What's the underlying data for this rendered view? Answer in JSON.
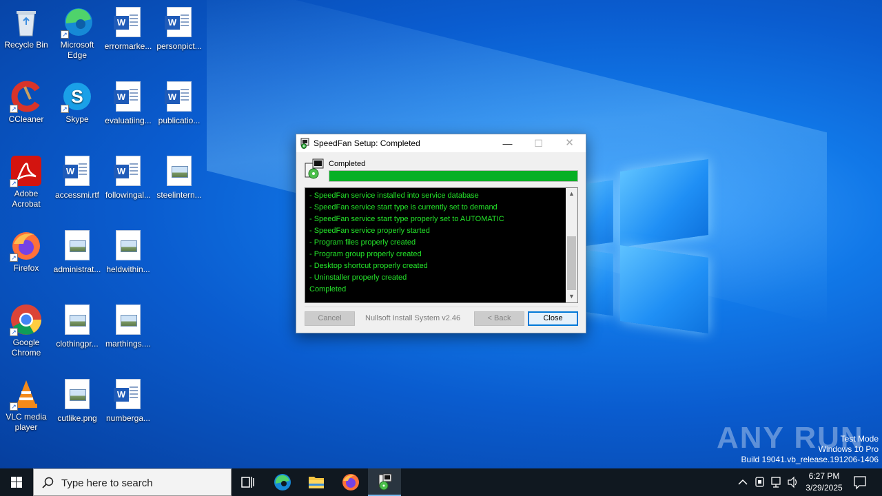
{
  "desktop": {
    "icons": [
      {
        "label": "Recycle Bin",
        "kind": "recycle-bin"
      },
      {
        "label": "Microsoft Edge",
        "kind": "edge"
      },
      {
        "label": "errormarke...",
        "kind": "word"
      },
      {
        "label": "personpict...",
        "kind": "word"
      },
      {
        "label": "CCleaner",
        "kind": "ccleaner"
      },
      {
        "label": "Skype",
        "kind": "skype"
      },
      {
        "label": "evaluatiing...",
        "kind": "word"
      },
      {
        "label": "publicatio...",
        "kind": "word"
      },
      {
        "label": "Adobe Acrobat",
        "kind": "acrobat"
      },
      {
        "label": "accessmi.rtf",
        "kind": "word"
      },
      {
        "label": "followingal...",
        "kind": "word"
      },
      {
        "label": "steelintern...",
        "kind": "image"
      },
      {
        "label": "Firefox",
        "kind": "firefox"
      },
      {
        "label": "administrat...",
        "kind": "image"
      },
      {
        "label": "heldwithin...",
        "kind": "image"
      },
      {
        "label": "Google Chrome",
        "kind": "chrome"
      },
      {
        "label": "clothingpr...",
        "kind": "image"
      },
      {
        "label": "marthings....",
        "kind": "image"
      },
      {
        "label": "VLC media player",
        "kind": "vlc"
      },
      {
        "label": "cutlike.png",
        "kind": "image"
      },
      {
        "label": "numberga...",
        "kind": "word"
      }
    ]
  },
  "dialog": {
    "title": "SpeedFan Setup: Completed",
    "minimize_glyph": "—",
    "maximize_glyph": "☐",
    "close_glyph": "✕",
    "status_label": "Completed",
    "progress_fraction": 1.0,
    "log": [
      "- SpeedFan service installed into service database",
      "- SpeedFan service start type is currently set to demand",
      "- SpeedFan service start type properly set to AUTOMATIC",
      "- SpeedFan service properly started",
      "- Program files properly created",
      "- Program group properly created",
      "- Desktop shortcut properly created",
      "- Uninstaller properly created",
      "Completed"
    ],
    "buttons": {
      "cancel": "Cancel",
      "back": "< Back",
      "close": "Close"
    },
    "branding": "Nullsoft Install System v2.46"
  },
  "watermark": {
    "brand": "ANY RUN",
    "lines": [
      "Test Mode",
      "Windows 10 Pro",
      "Build 19041.vb_release.191206-1406"
    ]
  },
  "taskbar": {
    "search_placeholder": "Type here to search",
    "time": "6:27 PM",
    "date": "3/29/2025"
  },
  "colors": {
    "progress": "#06b025",
    "log_text": "#24e52a",
    "taskbar": "#101820"
  }
}
